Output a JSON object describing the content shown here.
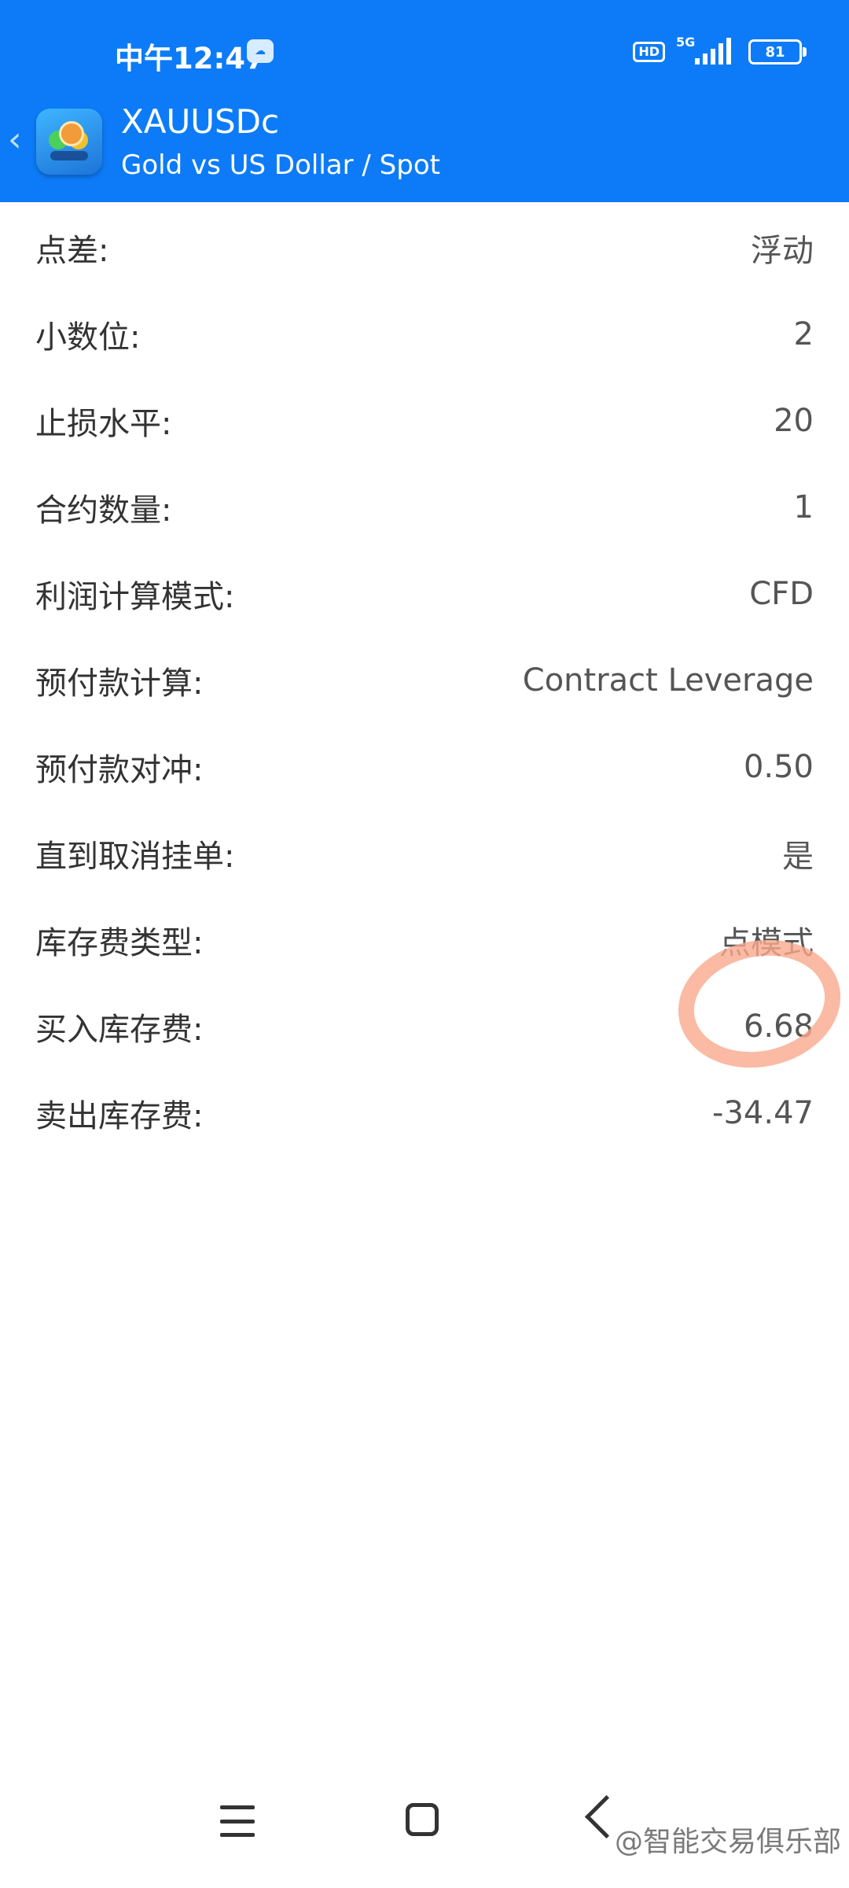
{
  "status_bar": {
    "time": "中午12:47",
    "network_type": "5G",
    "hd_label": "HD",
    "battery_level": "81",
    "signal_level": 4,
    "icons": [
      "cloud-icon",
      "hd-icon",
      "signal-icon",
      "battery-icon"
    ]
  },
  "header": {
    "symbol": "XAUUSDc",
    "description": "Gold vs US Dollar / Spot",
    "back_icon": "chevron-left-icon",
    "app_icon": "metatrader-app-icon"
  },
  "specs": [
    {
      "label": "点差:",
      "value": "浮动"
    },
    {
      "label": "小数位:",
      "value": "2"
    },
    {
      "label": "止损水平:",
      "value": "20"
    },
    {
      "label": "合约数量:",
      "value": "1"
    },
    {
      "label": "利润计算模式:",
      "value": "CFD"
    },
    {
      "label": "预付款计算:",
      "value": "Contract Leverage"
    },
    {
      "label": "预付款对冲:",
      "value": "0.50"
    },
    {
      "label": "直到取消挂单:",
      "value": "是"
    },
    {
      "label": "库存费类型:",
      "value": "点模式"
    },
    {
      "label": "买入库存费:",
      "value": "6.68"
    },
    {
      "label": "卖出库存费:",
      "value": "-34.47"
    }
  ],
  "highlight_color": "#f9a98d",
  "accent_color": "#0d7bf7",
  "navigation": {
    "icons": [
      "menu-icon",
      "home-icon",
      "back-icon"
    ]
  },
  "watermark": "@智能交易俱乐部"
}
